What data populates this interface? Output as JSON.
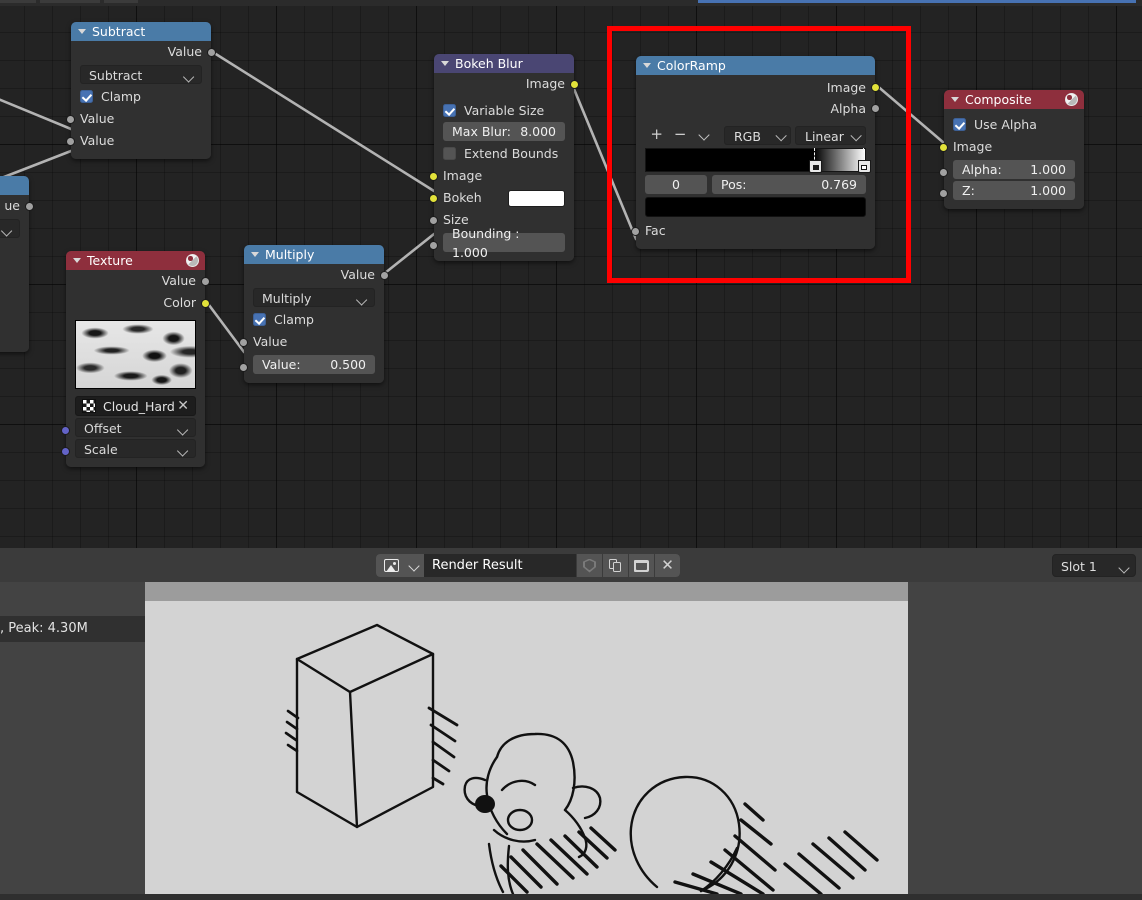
{
  "app": {
    "editor": "blender-compositor"
  },
  "node_editor": {
    "nodes": [
      {
        "id": "subtract",
        "title": "Subtract",
        "header_color": "#4a7ba7",
        "outputs": [
          {
            "label": "Value",
            "socket": "gray"
          }
        ],
        "operation": "Subtract",
        "clamp_label": "Clamp",
        "clamp_checked": true,
        "inputs": [
          {
            "label": "Value",
            "socket": "gray"
          },
          {
            "label": "Value",
            "socket": "gray"
          }
        ]
      },
      {
        "id": "texture",
        "title": "Texture",
        "header_color": "#8e2f3d",
        "outputs": [
          {
            "label": "Value",
            "socket": "gray"
          },
          {
            "label": "Color",
            "socket": "yellow"
          }
        ],
        "datablock": "Cloud_Hard",
        "inputs": [
          {
            "label": "Offset",
            "socket": "purple"
          },
          {
            "label": "Scale",
            "socket": "purple"
          }
        ]
      },
      {
        "id": "multiply",
        "title": "Multiply",
        "header_color": "#4a7ba7",
        "outputs": [
          {
            "label": "Value",
            "socket": "gray"
          }
        ],
        "operation": "Multiply",
        "clamp_label": "Clamp",
        "clamp_checked": true,
        "inputs": [
          {
            "label": "Value",
            "socket": "gray"
          },
          {
            "label": "Value:",
            "value": "0.500",
            "socket": "gray"
          }
        ]
      },
      {
        "id": "bokeh_blur",
        "title": "Bokeh Blur",
        "header_color": "#4a4673",
        "outputs": [
          {
            "label": "Image",
            "socket": "yellow"
          }
        ],
        "variable_size_label": "Variable Size",
        "variable_size_checked": true,
        "max_blur_label": "Max Blur:",
        "max_blur_value": "8.000",
        "extend_bounds_label": "Extend Bounds",
        "extend_bounds_checked": false,
        "inputs": [
          {
            "label": "Image",
            "socket": "yellow"
          },
          {
            "label": "Bokeh",
            "socket": "yellow",
            "swatch": "#ffffff"
          },
          {
            "label": "Size",
            "socket": "gray"
          },
          {
            "label": "Bounding : 1.000",
            "socket": "gray"
          }
        ]
      },
      {
        "id": "colorramp",
        "title": "ColorRamp",
        "header_color": "#4a7ba7",
        "outputs": [
          {
            "label": "Image",
            "socket": "yellow"
          },
          {
            "label": "Alpha",
            "socket": "gray"
          }
        ],
        "toolbar": {
          "add": "+",
          "remove": "−",
          "menu": "chevron-down-icon"
        },
        "color_mode": "RGB",
        "interpolation": "Linear",
        "stops": [
          {
            "position": 0.769,
            "color": "#000000"
          },
          {
            "position": 1.0,
            "color": "#ffffff"
          }
        ],
        "active_index": "0",
        "pos_label": "Pos:",
        "pos_value": "0.769",
        "active_color": "#000000",
        "inputs": [
          {
            "label": "Fac",
            "socket": "gray"
          }
        ]
      },
      {
        "id": "composite",
        "title": "Composite",
        "header_color": "#8e2f3d",
        "use_alpha_label": "Use Alpha",
        "use_alpha_checked": true,
        "inputs": [
          {
            "label": "Image",
            "socket": "yellow"
          },
          {
            "label": "Alpha:",
            "value": "1.000",
            "socket": "gray"
          },
          {
            "label": "Z:",
            "value": "1.000",
            "socket": "gray"
          }
        ]
      }
    ],
    "highlight": {
      "color": "#ff0000",
      "target": "colorramp"
    }
  },
  "image_editor": {
    "image_type_icon": "image-icon",
    "image_name": "Render Result",
    "buttons": [
      {
        "icon": "shield-icon",
        "name": "fake-user-button"
      },
      {
        "icon": "copy-icon",
        "name": "new-image-button"
      },
      {
        "icon": "folder-icon",
        "name": "open-image-button"
      },
      {
        "icon": "close-icon",
        "name": "unlink-image-button"
      }
    ],
    "slot": "Slot 1",
    "stats": ", Peak: 4.30M"
  }
}
